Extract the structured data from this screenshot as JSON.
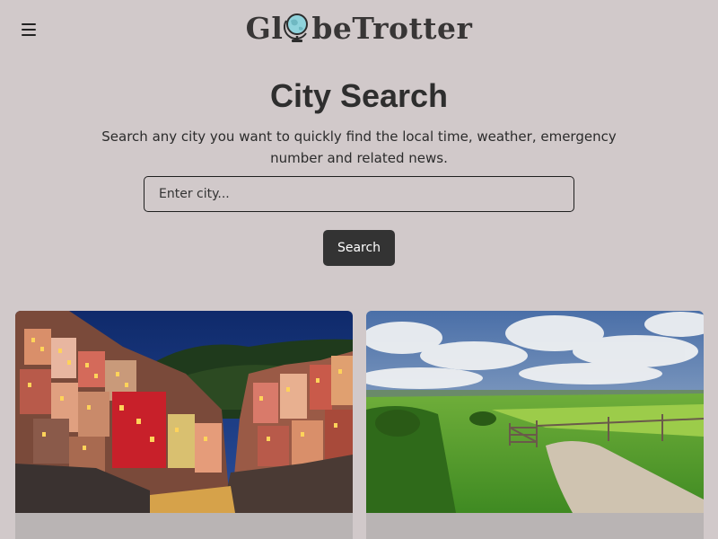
{
  "header": {
    "logo_prefix": "Gl",
    "logo_suffix": "beTrotter",
    "menu_icon": "hamburger-icon"
  },
  "main": {
    "title": "City Search",
    "subtitle": "Search any city you want to quickly find the local time, weather, emergency number and related news."
  },
  "search": {
    "placeholder": "Enter city...",
    "value": "",
    "button_label": "Search"
  },
  "cards": [
    {
      "image": "coastal-village-at-night-photo"
    },
    {
      "image": "green-countryside-path-photo"
    }
  ],
  "colors": {
    "background": "#d1c9ca",
    "button": "#333333",
    "card_footer": "#b9b4b4"
  }
}
